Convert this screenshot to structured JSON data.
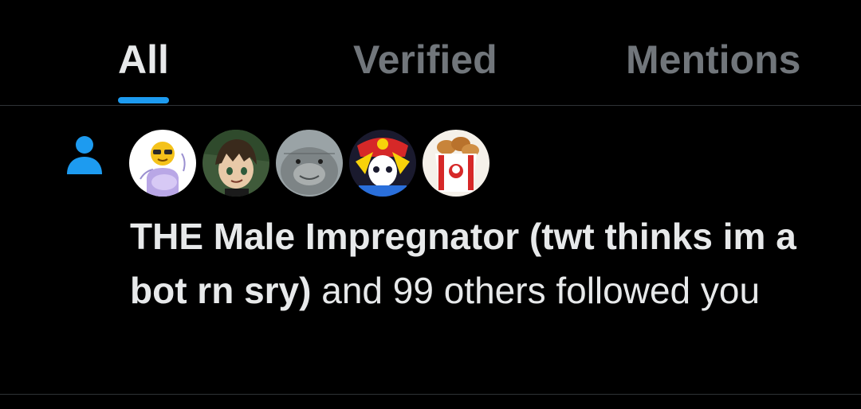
{
  "tabs": [
    {
      "label": "All",
      "active": true
    },
    {
      "label": "Verified",
      "active": false
    },
    {
      "label": "Mentions",
      "active": false
    }
  ],
  "accent_color": "#1d9bf0",
  "notification": {
    "type_icon": "person-icon",
    "avatars": [
      "emoji-avatar",
      "anime-boy-avatar",
      "seal-avatar",
      "cartoon-avatar",
      "kfc-bucket-avatar"
    ],
    "user_name": "THE Male Impregnator (twt thinks im a bot rn sry)",
    "rest_text": " and 99 others followed you"
  }
}
